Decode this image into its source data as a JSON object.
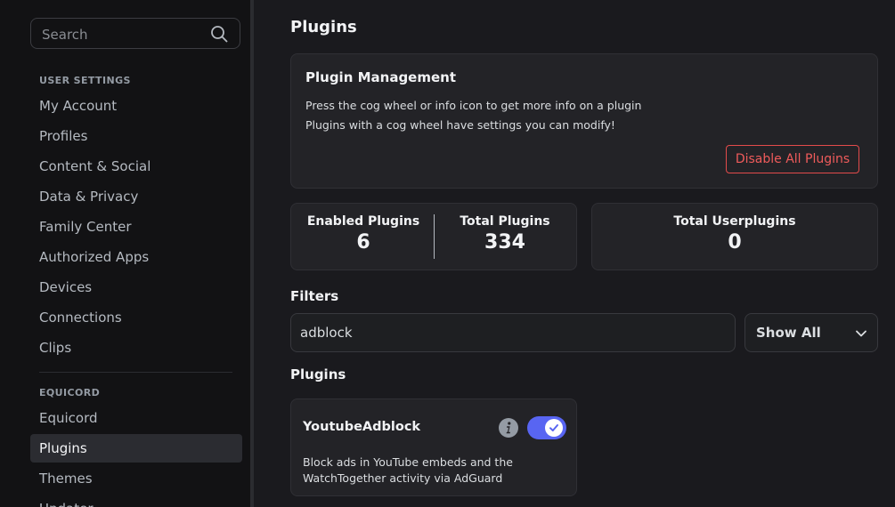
{
  "sidebar": {
    "search_placeholder": "Search",
    "sections": {
      "user_settings": "USER SETTINGS",
      "equicord": "EQUICORD"
    },
    "user_items": [
      "My Account",
      "Profiles",
      "Content & Social",
      "Data & Privacy",
      "Family Center",
      "Authorized Apps",
      "Devices",
      "Connections",
      "Clips"
    ],
    "equicord_items": [
      "Equicord",
      "Plugins",
      "Themes",
      "Updater"
    ],
    "active_item": "Plugins"
  },
  "main": {
    "title": "Plugins",
    "plugin_management": {
      "title": "Plugin Management",
      "line1": "Press the cog wheel or info icon to get more info on a plugin",
      "line2": "Plugins with a cog wheel have settings you can modify!",
      "disable_button": "Disable All Plugins"
    },
    "stats": {
      "enabled_label": "Enabled Plugins",
      "enabled_value": "6",
      "total_label": "Total Plugins",
      "total_value": "334",
      "userplugins_label": "Total Userplugins",
      "userplugins_value": "0"
    },
    "filters": {
      "title": "Filters",
      "search_value": "adblock",
      "select_value": "Show All"
    },
    "plugins_section": {
      "title": "Plugins",
      "items": [
        {
          "name": "YoutubeAdblock",
          "description": "Block ads in YouTube embeds and the WatchTogether activity via AdGuard",
          "enabled": true
        }
      ]
    }
  },
  "colors": {
    "accent": "#5865f2",
    "danger": "#ef5b5b",
    "background": "#1a1a1e",
    "sidebar": "#121214",
    "card": "#232327"
  },
  "icons": [
    "search-icon",
    "chevron-down-icon",
    "info-icon",
    "check-icon"
  ]
}
